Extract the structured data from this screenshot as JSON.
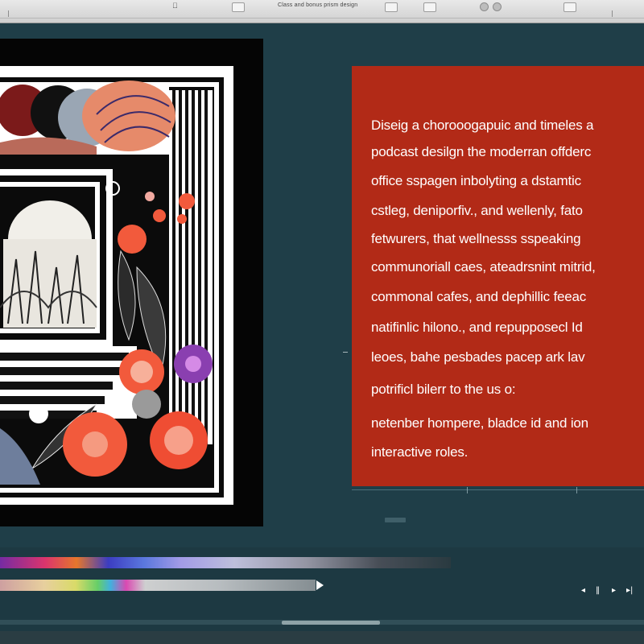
{
  "window": {
    "title": "Class and bonus prism design"
  },
  "icons": {
    "apple": "apple-icon",
    "play": "play-icon",
    "step_back": "step-back-icon",
    "step_forward": "step-forward-icon",
    "skip_end": "skip-end-icon"
  },
  "text_card": {
    "lines": [
      "Diseig a chorooogapuic and timeles a",
      "podcast desilgn the moderran offderc",
      "office sspagen  inbolyting a dstamtic",
      "cstleg,  deniporfiv., and wellenly, fato",
      "fetwurers, that wellnesss  sspeaking",
      "communoriall caes, ateadrsnint mitrid,",
      "commonal cafes, and dephillic feeac",
      "natifinlic hilono., and  repupposecl Id",
      "leoes, bahe  pesbades pacep  ark lav",
      "potrificl bilerr to the us o:",
      "netenber hompere, bladce id and ion",
      "interactive roles."
    ]
  },
  "transport": {
    "step_back": "◂",
    "pause": "‖",
    "play": "▸",
    "skip_end": "▸|"
  },
  "colors": {
    "background": "#1f3e48",
    "card": "#b22a17",
    "card_text": "#ffffff",
    "artboard": "#ffffff",
    "accent_orange": "#f25a3c",
    "accent_purple": "#8a3fb0"
  }
}
